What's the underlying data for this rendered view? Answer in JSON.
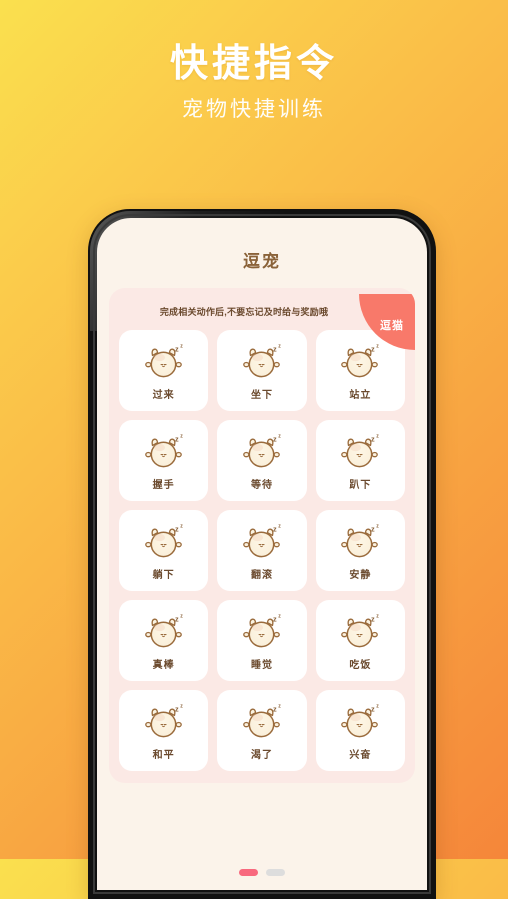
{
  "promo": {
    "title": "快捷指令",
    "subtitle": "宠物快捷训练",
    "title_color": "#FFFFFF",
    "bg_gradient_from": "#FAE04E",
    "bg_gradient_to": "#F5863A"
  },
  "app": {
    "screen_title": "逗宠",
    "panel": {
      "hint": "完成相关动作后,不要忘记及时给与奖励哦",
      "corner_badge": "逗猫",
      "corner_badge_color": "#F8796A"
    },
    "commands": [
      {
        "label": "过来",
        "icon": "sleeping-pet-icon"
      },
      {
        "label": "坐下",
        "icon": "sleeping-pet-icon"
      },
      {
        "label": "站立",
        "icon": "sleeping-pet-icon"
      },
      {
        "label": "握手",
        "icon": "sleeping-pet-icon"
      },
      {
        "label": "等待",
        "icon": "sleeping-pet-icon"
      },
      {
        "label": "趴下",
        "icon": "sleeping-pet-icon"
      },
      {
        "label": "躺下",
        "icon": "sleeping-pet-icon"
      },
      {
        "label": "翻滚",
        "icon": "sleeping-pet-icon"
      },
      {
        "label": "安静",
        "icon": "sleeping-pet-icon"
      },
      {
        "label": "真棒",
        "icon": "sleeping-pet-icon"
      },
      {
        "label": "睡觉",
        "icon": "sleeping-pet-icon"
      },
      {
        "label": "吃饭",
        "icon": "sleeping-pet-icon"
      },
      {
        "label": "和平",
        "icon": "sleeping-pet-icon"
      },
      {
        "label": "渴了",
        "icon": "sleeping-pet-icon"
      },
      {
        "label": "兴奋",
        "icon": "sleeping-pet-icon"
      }
    ],
    "pagination": {
      "total": 2,
      "active_index": 0,
      "active_color": "#F8697E",
      "inactive_color": "#DDDDDD"
    }
  }
}
